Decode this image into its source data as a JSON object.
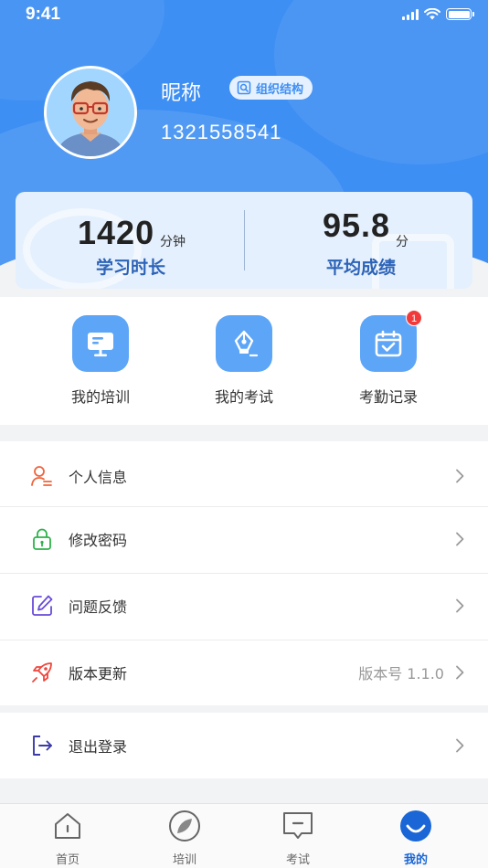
{
  "status_bar": {
    "time": "9:41"
  },
  "profile": {
    "nickname": "昵称",
    "org_button": "组织结构",
    "phone": "1321558541"
  },
  "stats": {
    "study": {
      "value": "1420",
      "unit": "分钟",
      "label": "学习时长"
    },
    "score": {
      "value": "95.8",
      "unit": "分",
      "label": "平均成绩"
    }
  },
  "quick_actions": [
    {
      "label": "我的培训",
      "icon": "monitor-icon"
    },
    {
      "label": "我的考试",
      "icon": "pen-icon"
    },
    {
      "label": "考勤记录",
      "icon": "calendar-check-icon",
      "badge": "1"
    }
  ],
  "menu": [
    {
      "label": "个人信息",
      "icon": "person-icon",
      "color": "#f0643c"
    },
    {
      "label": "修改密码",
      "icon": "lock-icon",
      "color": "#2db34a"
    },
    {
      "label": "问题反馈",
      "icon": "edit-icon",
      "color": "#6a4cd6"
    },
    {
      "label": "版本更新",
      "icon": "rocket-icon",
      "color": "#f0463c",
      "value": "版本号 1.1.0"
    },
    {
      "label": "退出登录",
      "icon": "logout-icon",
      "color": "#3a3aa8"
    }
  ],
  "tabs": [
    {
      "label": "首页",
      "icon": "home-icon"
    },
    {
      "label": "培训",
      "icon": "leaf-icon"
    },
    {
      "label": "考试",
      "icon": "exam-icon"
    },
    {
      "label": "我的",
      "icon": "user-face-icon",
      "active": true
    }
  ],
  "colors": {
    "primary": "#3e8ff3",
    "tile": "#5da5f6",
    "active_tab": "#1a66d6",
    "badge": "#f23a3a"
  }
}
